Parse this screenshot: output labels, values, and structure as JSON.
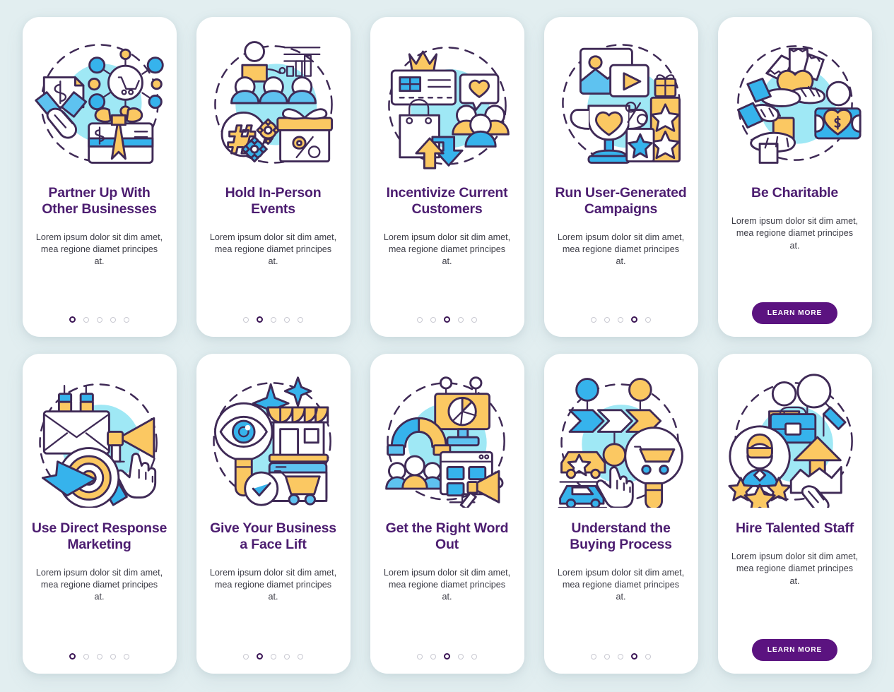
{
  "page": {
    "background_color": "#e2eef0",
    "card_background": "#ffffff",
    "title_color": "#4c1d70",
    "accent_button_color": "#5b1380",
    "illustration_blue": "#36b3ec",
    "illustration_yellow": "#fbc862",
    "illustration_cyan_blob": "#9fe8f5",
    "illustration_outline": "#3f2a56",
    "dot_active_color": "#3b1555",
    "dot_inactive_color": "#c9c9d2"
  },
  "body_text": "Lorem ipsum dolor sit dim amet, mea regione diamet principes at.",
  "learn_more_label": "LEARN MORE",
  "cards": [
    {
      "id": "partner-up-with-other-businesses",
      "title": "Partner Up With Other Businesses",
      "body": "Lorem ipsum dolor sit dim amet, mea regione diamet principes at.",
      "dots_total": 5,
      "active_dot": 1,
      "has_learn_more": false,
      "illustration": "handshake-shopping-network-giftcard-icon"
    },
    {
      "id": "hold-in-person-events",
      "title": "Hold In-Person Events",
      "body": "Lorem ipsum dolor sit dim amet, mea regione diamet principes at.",
      "dots_total": 5,
      "active_dot": 2,
      "has_learn_more": false,
      "illustration": "presentation-audience-hashtag-gift-icon"
    },
    {
      "id": "incentivize-current-customers",
      "title": "Incentivize Current Customers",
      "body": "Lorem ipsum dolor sit dim amet, mea regione diamet principes at.",
      "dots_total": 5,
      "active_dot": 3,
      "has_learn_more": false,
      "illustration": "loyalty-card-crown-shopping-bag-customers-icon"
    },
    {
      "id": "run-user-generated-campaigns",
      "title": "Run User-Generated Campaigns",
      "body": "Lorem ipsum dolor sit dim amet, mea regione diamet principes at.",
      "dots_total": 5,
      "active_dot": 4,
      "has_learn_more": false,
      "illustration": "trophy-video-stars-rewards-icon"
    },
    {
      "id": "be-charitable",
      "title": "Be Charitable",
      "body": "Lorem ipsum dolor sit dim amet, mea regione diamet principes at.",
      "dots_total": 0,
      "active_dot": 0,
      "has_learn_more": true,
      "illustration": "donation-hands-heart-money-icon"
    },
    {
      "id": "use-direct-response-marketing",
      "title": "Use Direct Response Marketing",
      "body": "Lorem ipsum dolor sit dim amet, mea regione diamet principes at.",
      "dots_total": 5,
      "active_dot": 1,
      "has_learn_more": false,
      "illustration": "email-magnet-megaphone-target-icon"
    },
    {
      "id": "give-your-business-a-face-lift",
      "title": "Give Your Business a Face Lift",
      "body": "Lorem ipsum dolor sit dim amet, mea regione diamet principes at.",
      "dots_total": 5,
      "active_dot": 2,
      "has_learn_more": false,
      "illustration": "storefront-eye-magnifier-ecommerce-icon"
    },
    {
      "id": "get-the-right-word-out",
      "title": "Get the Right Word Out",
      "body": "Lorem ipsum dolor sit dim amet, mea regione diamet principes at.",
      "dots_total": 5,
      "active_dot": 3,
      "has_learn_more": false,
      "illustration": "billboard-audience-megaphone-browser-icon"
    },
    {
      "id": "understand-the-buying-process",
      "title": "Understand the Buying Process",
      "body": "Lorem ipsum dolor sit dim amet, mea regione diamet principes at.",
      "dots_total": 5,
      "active_dot": 4,
      "has_learn_more": false,
      "illustration": "buying-funnel-car-cart-hand-icon"
    },
    {
      "id": "hire-talented-staff",
      "title": "Hire Talented Staff",
      "body": "Lorem ipsum dolor sit dim amet, mea regione diamet principes at.",
      "dots_total": 0,
      "active_dot": 0,
      "has_learn_more": true,
      "illustration": "recruiter-magnifier-stars-handshake-icon"
    }
  ]
}
